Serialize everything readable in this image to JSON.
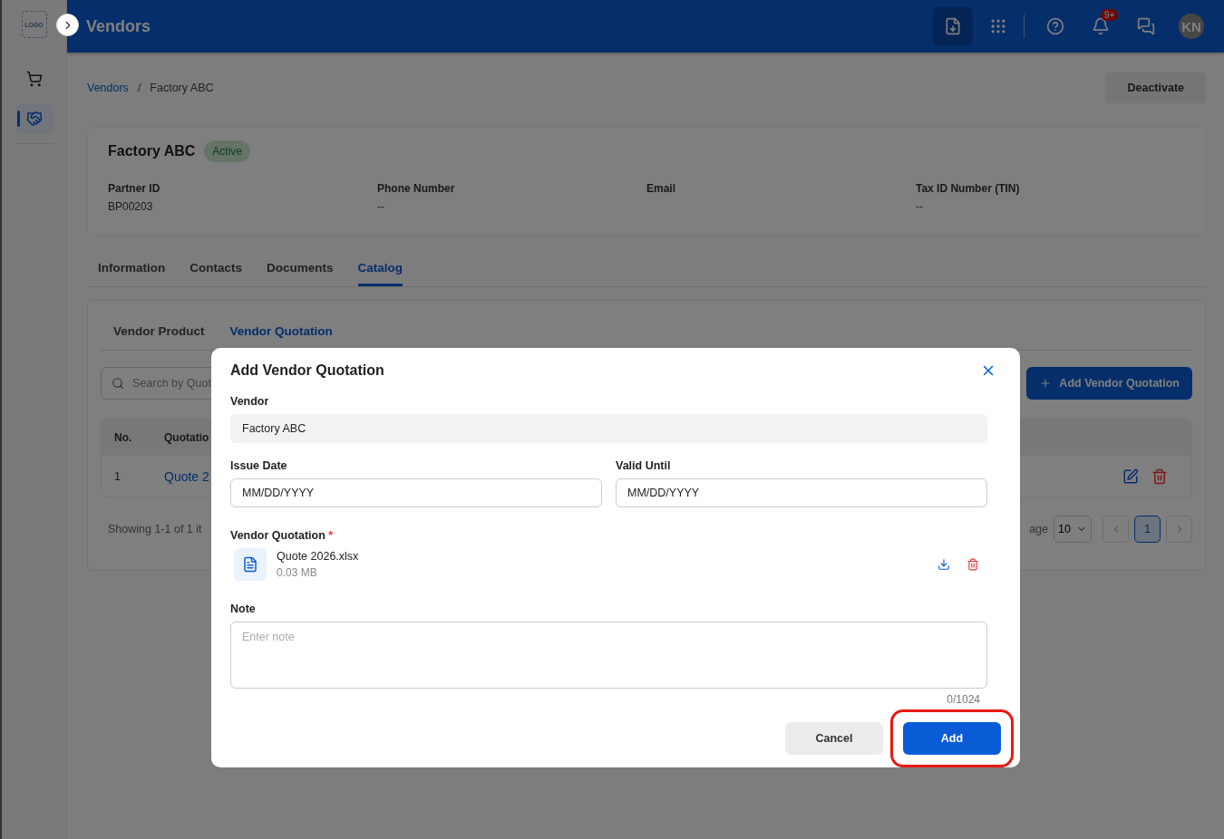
{
  "header": {
    "logo": "LOGO",
    "title": "Vendors",
    "notifications": "9+",
    "avatar": "KN"
  },
  "sidebar": {
    "items": [
      {
        "selected": false
      },
      {
        "selected": true
      }
    ]
  },
  "breadcrumb": [
    "Vendors",
    "/",
    "Factory ABC"
  ],
  "deactivate": "Deactivate",
  "vendor": {
    "name": "Factory ABC",
    "status": "Active",
    "fields": [
      {
        "label": "Partner ID",
        "value": "BP00203"
      },
      {
        "label": "Phone Number",
        "value": "--"
      },
      {
        "label": "Email"
      },
      {
        "label": "Tax ID Number (TIN)",
        "value": "--"
      }
    ]
  },
  "tabs": [
    {
      "label": "Information",
      "selected": false
    },
    {
      "label": "Contacts",
      "selected": false
    },
    {
      "label": "Documents",
      "selected": false
    },
    {
      "label": "Catalog",
      "selected": true
    }
  ],
  "catalog": {
    "subtabs": [
      {
        "label": "Vendor Product",
        "selected": false
      },
      {
        "label": "Vendor Quotation",
        "selected": true
      }
    ],
    "search": {
      "placeholder": "Search by Quot"
    },
    "add_button": "Add Vendor Quotation",
    "columns": [
      "No.",
      "Quotatio"
    ],
    "rows": [
      {
        "no": "1",
        "quotation": "Quote 2"
      }
    ],
    "showing": "Showing 1-1 of 1 it",
    "per_page_label": "age",
    "per_page": "10",
    "pages": [
      {
        "label": "1",
        "selected": true
      }
    ]
  },
  "modal": {
    "title": "Add Vendor Quotation",
    "vendor": {
      "label": "Vendor",
      "value": "Factory ABC"
    },
    "issue_date": {
      "label": "Issue Date",
      "placeholder": "MM/DD/YYYY"
    },
    "valid_until": {
      "label": "Valid Until",
      "placeholder": "MM/DD/YYYY"
    },
    "quotation": {
      "label": "Vendor Quotation",
      "required": "*",
      "file": "Quote 2026.xlsx",
      "size": "0.03 MB"
    },
    "note": {
      "label": "Note",
      "placeholder": "Enter note",
      "counter": "0/1024"
    },
    "buttons": [
      {
        "label": "Cancel",
        "kind": "secondary",
        "highlighted": false
      },
      {
        "label": "Add",
        "kind": "primary",
        "highlighted": true
      }
    ]
  }
}
